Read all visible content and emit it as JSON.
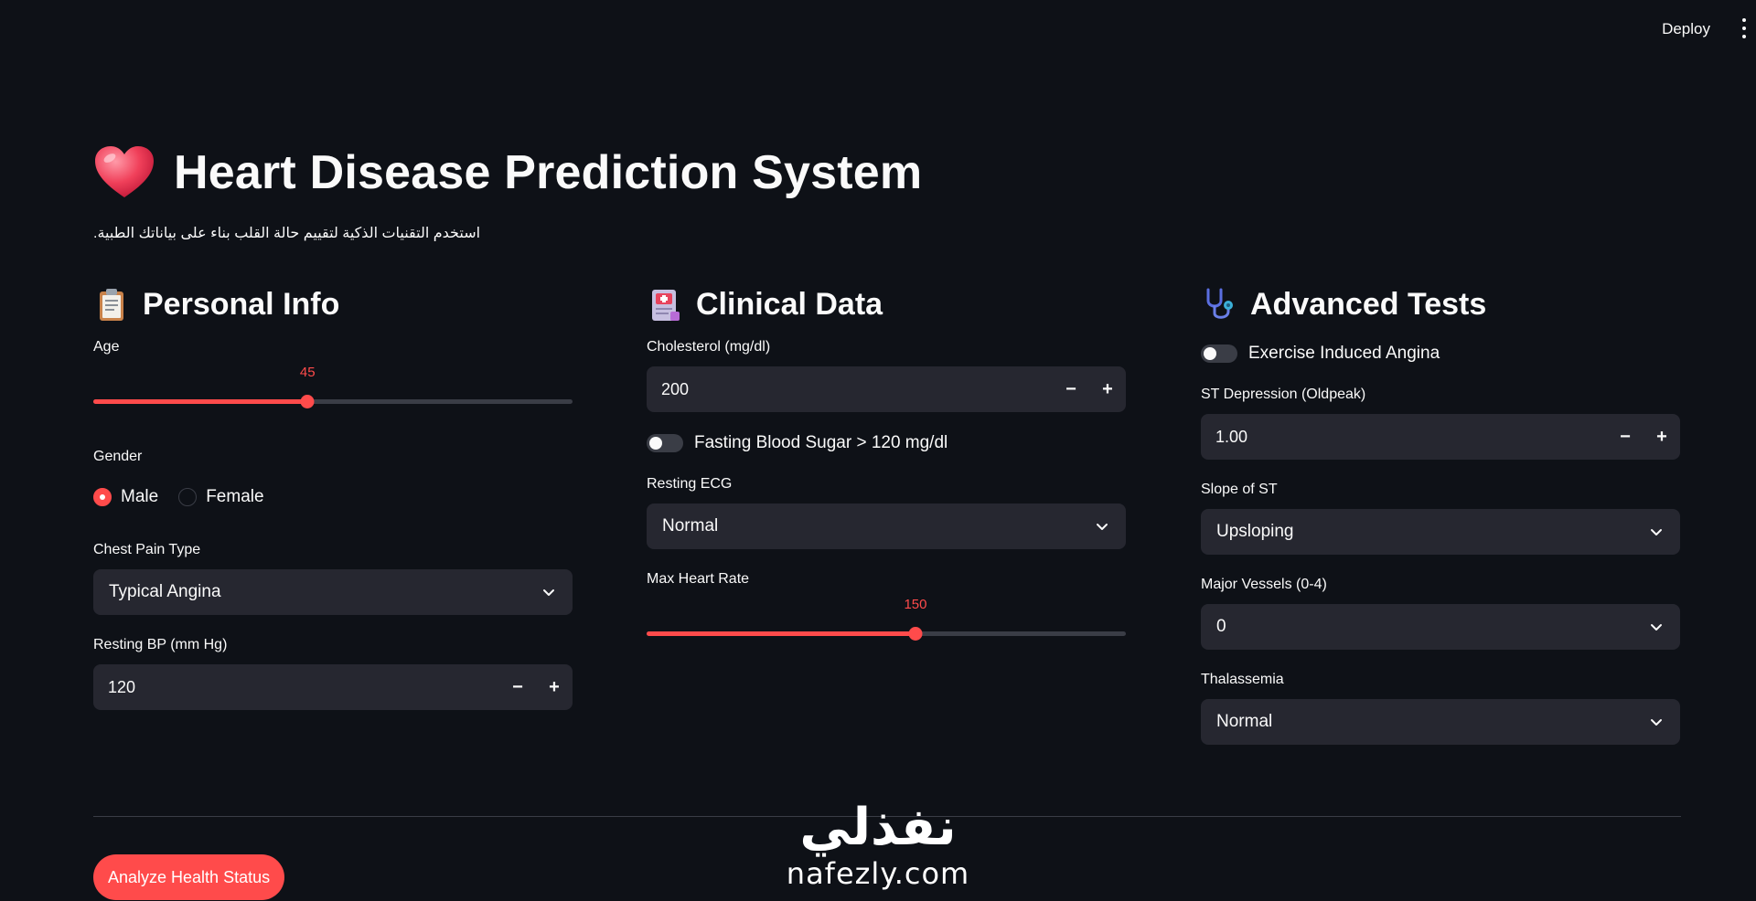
{
  "toolbar": {
    "deploy_label": "Deploy",
    "menu_icon": "kebab-menu-icon"
  },
  "header": {
    "title": "Heart Disease Prediction System",
    "title_icon": "heart-icon",
    "subtitle": "استخدم التقنيات الذكية لتقييم حالة القلب بناء على بياناتك الطبية."
  },
  "personal": {
    "title": "Personal Info",
    "icon": "clipboard-icon",
    "age": {
      "label": "Age",
      "value": "45",
      "fraction": 0.447
    },
    "gender": {
      "label": "Gender",
      "options": [
        "Male",
        "Female"
      ],
      "selected": "Male"
    },
    "chest_pain": {
      "label": "Chest Pain Type",
      "value": "Typical Angina"
    },
    "resting_bp": {
      "label": "Resting BP (mm Hg)",
      "value": "120"
    }
  },
  "clinical": {
    "title": "Clinical Data",
    "icon": "medical-record-icon",
    "cholesterol": {
      "label": "Cholesterol (mg/dl)",
      "value": "200"
    },
    "fasting_sugar": {
      "label": "Fasting Blood Sugar > 120 mg/dl",
      "checked": false
    },
    "resting_ecg": {
      "label": "Resting ECG",
      "value": "Normal"
    },
    "max_hr": {
      "label": "Max Heart Rate",
      "value": "150",
      "fraction": 0.561
    }
  },
  "advanced": {
    "title": "Advanced Tests",
    "icon": "stethoscope-icon",
    "exercise_angina": {
      "label": "Exercise Induced Angina",
      "checked": false
    },
    "oldpeak": {
      "label": "ST Depression (Oldpeak)",
      "value": "1.00"
    },
    "slope": {
      "label": "Slope of ST",
      "value": "Upsloping"
    },
    "vessels": {
      "label": "Major Vessels (0-4)",
      "value": "0"
    },
    "thal": {
      "label": "Thalassemia",
      "value": "Normal"
    }
  },
  "actions": {
    "analyze_label": "Analyze Health Status"
  },
  "stepper": {
    "minus": "−",
    "plus": "+"
  },
  "watermark": {
    "arabic": "نفذلي",
    "latin": "nafezly.com"
  },
  "colors": {
    "background": "#0e1117",
    "accent": "#ff4b4b",
    "widget_bg": "#262730",
    "track": "#3a3d46"
  }
}
